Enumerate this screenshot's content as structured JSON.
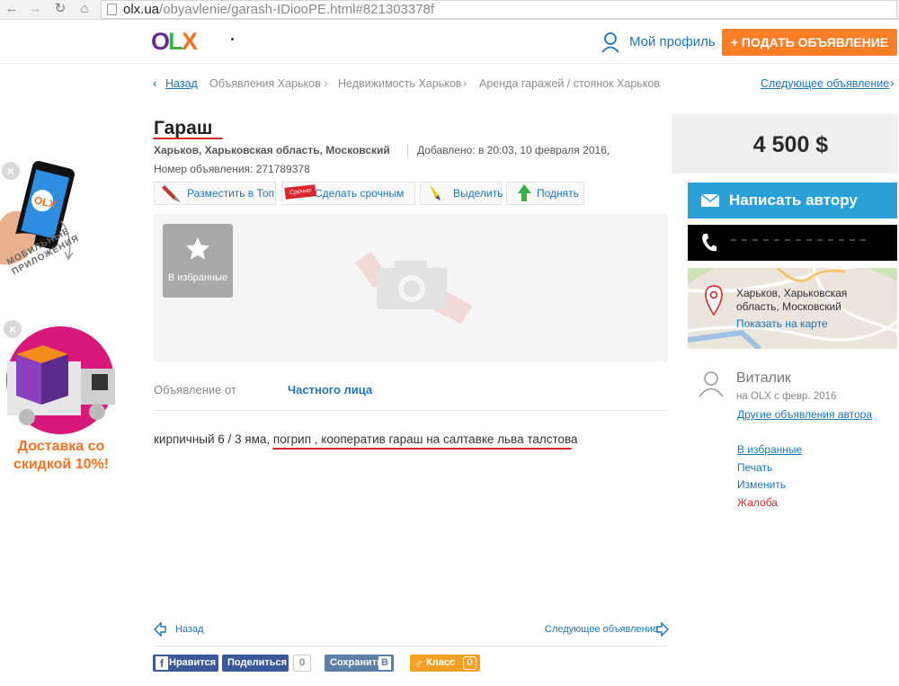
{
  "browser": {
    "url_host": "olx.ua",
    "url_path": "/obyavlenie/garash-IDiooPE.html#821303378f"
  },
  "header": {
    "logo": "OLX",
    "profile_label": "Мой профиль",
    "post_label": "+ ПОДАТЬ ОБЪЯВЛЕНИЕ"
  },
  "breadcrumb": {
    "back": "Назад",
    "items": [
      "Объявления Харьков",
      "Недвижимость Харьков",
      "Аренда гаражей / стоянок Харьков"
    ],
    "next": "Следующее объявление"
  },
  "listing": {
    "title": "Гараш",
    "location": "Харьков, Харьковская область, Московский",
    "added": "Добавлено: в 20:03, 10 февраля 2016,",
    "number": "Номер объявления: 271789378",
    "actions": [
      "Разместить в Топ",
      "Сделать срочным",
      "Выделить",
      "Поднять"
    ],
    "urgent_tag": "Срочно",
    "favorite_label": "В избранные",
    "seller_label": "Объявление от",
    "seller_type": "Частного лица",
    "description_plain": "кирпичный 6 / 3 яма, ",
    "description_marked": "погрип , кооператив гараш на салтавке льва талстова"
  },
  "bottom": {
    "back": "Назад",
    "next": "Следующее объявление",
    "like": "Нравится",
    "share": "Поделиться",
    "share_count": "0",
    "save": "Сохранить",
    "vk": "B",
    "ok": "Класс",
    "ok_count": "0"
  },
  "sidebar": {
    "price": "4 500 $",
    "write_label": "Написать автору",
    "map_line1": "Харьков, Харьковская",
    "map_line2": "область, Московский",
    "map_link": "Показать на карте",
    "user_name": "Виталик",
    "user_since": "на OLX с февр. 2016",
    "other_ads": "Другие объявления автора",
    "links": [
      "В избранные",
      "Печать",
      "Изменить",
      "Жалоба"
    ]
  },
  "ads": {
    "app_caption": "МОБИЛЬНЫЕ ПРИЛОЖЕНИЯ",
    "delivery_line1": "Доставка со",
    "delivery_line2": "скидкой 10%!",
    "app_logo": "OLX"
  },
  "colors": {
    "brand_orange": "#ff7e26",
    "link_blue": "#1d75b3",
    "write_button": "#2b9fd8",
    "underline_red": "#d9262b"
  }
}
